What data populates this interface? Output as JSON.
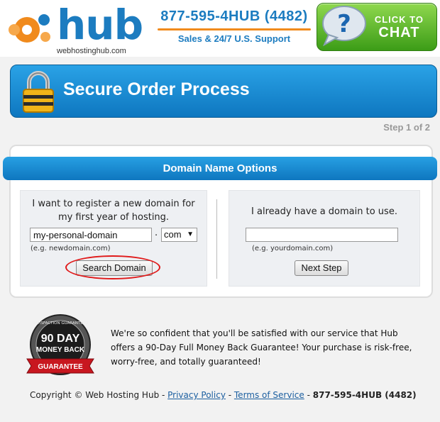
{
  "logo": {
    "brand": "hub",
    "domain": "webhostinghub.com"
  },
  "header": {
    "phone": "877-595-4HUB (4482)",
    "support": "Sales & 24/7 U.S. Support",
    "chat": {
      "line1": "CLICK TO",
      "line2": "CHAT"
    }
  },
  "banner": {
    "title": "Secure Order Process"
  },
  "step": "Step 1 of 2",
  "domain_options": {
    "title": "Domain Name Options",
    "new_domain": {
      "text": "I want to register a new domain for my first year of hosting.",
      "value": "my-personal-domain",
      "dot": ".",
      "tld": "com",
      "hint": "(e.g. newdomain.com)",
      "button": "Search Domain"
    },
    "existing_domain": {
      "text": "I already have a domain to use.",
      "value": "",
      "hint": "(e.g. yourdomain.com)",
      "button": "Next Step"
    }
  },
  "seal": {
    "top": "SATISFACTION GUARANTEED",
    "days": "90 DAY",
    "money": "MONEY BACK",
    "ribbon": "GUARANTEE"
  },
  "guarantee_text": "We're so confident that you'll be satisfied with our service that Hub offers a 90-Day Full Money Back Guarantee! Your purchase is risk-free, worry-free, and totally guaranteed!",
  "footer": {
    "copyright": "Copyright © Web Hosting Hub - ",
    "privacy": "Privacy Policy",
    "sep1": " - ",
    "terms": "Terms of Service",
    "sep2": " - ",
    "phone": "877-595-4HUB (4482)"
  },
  "colors": {
    "brand_blue": "#1c7cc0",
    "accent_orange": "#f08a1c",
    "chat_green": "#4caf1e",
    "highlight_red": "#e01a1a"
  }
}
